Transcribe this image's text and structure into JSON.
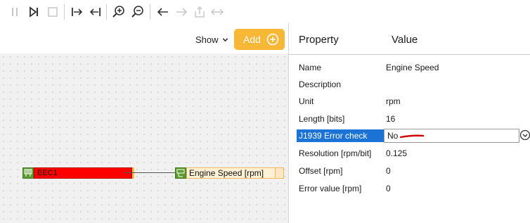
{
  "toolbar": {
    "buttons": [
      {
        "name": "pause-icon",
        "enabled": false
      },
      {
        "name": "step-play-icon",
        "enabled": true
      },
      {
        "name": "stop-icon",
        "enabled": false
      },
      {
        "name": "step-into-icon",
        "enabled": true
      },
      {
        "name": "step-out-icon",
        "enabled": true
      },
      {
        "name": "zoom-in-icon",
        "enabled": true
      },
      {
        "name": "zoom-out-icon",
        "enabled": true
      },
      {
        "name": "back-arrow-icon",
        "enabled": true
      },
      {
        "name": "forward-arrow-icon",
        "enabled": false
      },
      {
        "name": "export-icon",
        "enabled": false
      },
      {
        "name": "swap-arrows-icon",
        "enabled": false
      }
    ]
  },
  "canvas": {
    "show_label": "Show",
    "add_label": "Add",
    "nodes": {
      "message_label": "EEC1",
      "signal_label": "Engine Speed [rpm]"
    }
  },
  "panel": {
    "header_property": "Property",
    "header_value": "Value",
    "rows": [
      {
        "key": "Name",
        "value": "Engine Speed"
      },
      {
        "key": "Description",
        "value": ""
      },
      {
        "key": "Unit",
        "value": "rpm"
      },
      {
        "key": "Length [bits]",
        "value": "16"
      },
      {
        "key": "J1939 Error check",
        "value": "No"
      },
      {
        "key": "Resolution [rpm/bit]",
        "value": "0.125"
      },
      {
        "key": "Offset [rpm]",
        "value": "0"
      },
      {
        "key": "Error value [rpm]",
        "value": "0"
      }
    ],
    "selected_row": 4
  },
  "colors": {
    "accent_orange": "#f8b737",
    "selection_blue": "#1c73d6",
    "message_red": "#ff0000",
    "node_green": "#5a9a2e",
    "annotation_red": "#d40000"
  }
}
